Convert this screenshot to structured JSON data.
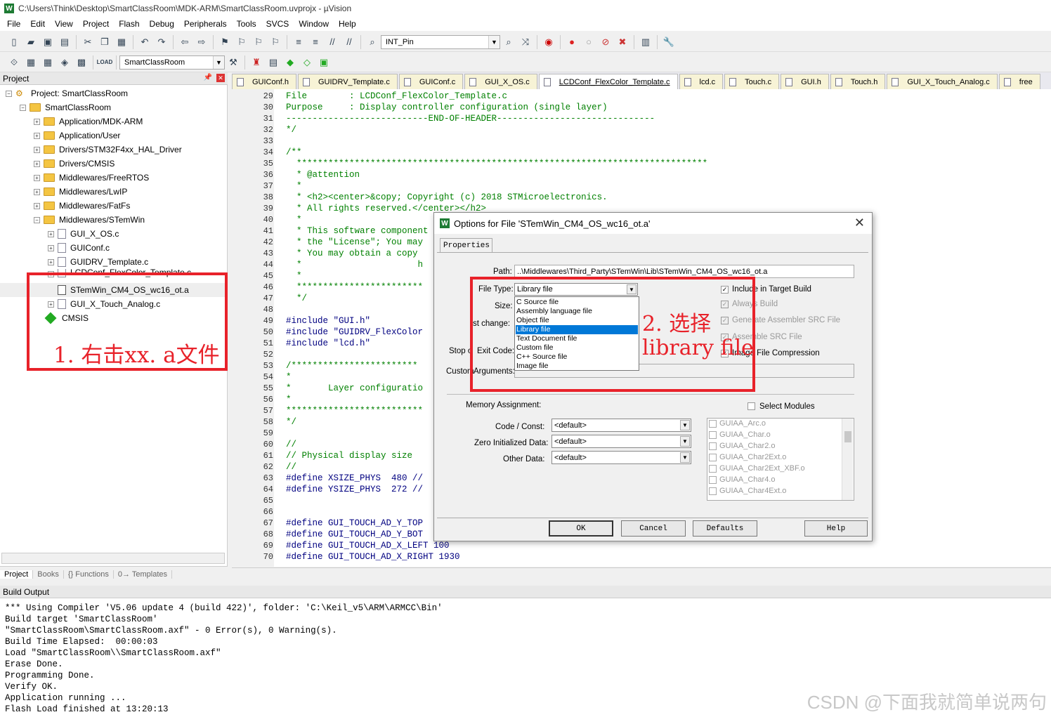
{
  "window": {
    "title": "C:\\Users\\Think\\Desktop\\SmartClassRoom\\MDK-ARM\\SmartClassRoom.uvprojx - µVision",
    "app_icon": "W"
  },
  "menu": [
    "File",
    "Edit",
    "View",
    "Project",
    "Flash",
    "Debug",
    "Peripherals",
    "Tools",
    "SVCS",
    "Window",
    "Help"
  ],
  "toolbar": {
    "find_combo": "INT_Pin",
    "target_combo": "SmartClassRoom",
    "load_label": "LOAD"
  },
  "project_panel": {
    "title": "Project",
    "tree": [
      {
        "label": "Project: SmartClassRoom"
      },
      {
        "label": "SmartClassRoom"
      },
      {
        "label": "Application/MDK-ARM"
      },
      {
        "label": "Application/User"
      },
      {
        "label": "Drivers/STM32F4xx_HAL_Driver"
      },
      {
        "label": "Drivers/CMSIS"
      },
      {
        "label": "Middlewares/FreeRTOS"
      },
      {
        "label": "Middlewares/LwIP"
      },
      {
        "label": "Middlewares/FatFs"
      },
      {
        "label": "Middlewares/STemWin"
      },
      {
        "label": "GUI_X_OS.c"
      },
      {
        "label": "GUIConf.c"
      },
      {
        "label": "GUIDRV_Template.c"
      },
      {
        "label": "LCDConf_FlexColor_Template.c"
      },
      {
        "label": "STemWin_CM4_OS_wc16_ot.a"
      },
      {
        "label": "GUI_X_Touch_Analog.c"
      },
      {
        "label": "CMSIS"
      }
    ],
    "tabs": [
      "Project",
      "Books",
      "{} Functions",
      "0→ Templates"
    ]
  },
  "file_tabs": [
    "GUIConf.h",
    "GUIDRV_Template.c",
    "GUIConf.c",
    "GUI_X_OS.c",
    "LCDConf_FlexColor_Template.c",
    "lcd.c",
    "Touch.c",
    "GUI.h",
    "Touch.h",
    "GUI_X_Touch_Analog.c",
    "free"
  ],
  "editor": {
    "lines": [
      {
        "n": "29",
        "t": "File        : LCDConf_FlexColor_Template.c",
        "c": "cm"
      },
      {
        "n": "30",
        "t": "Purpose     : Display controller configuration (single layer)",
        "c": "cm"
      },
      {
        "n": "31",
        "t": "---------------------------END-OF-HEADER------------------------------",
        "c": "cm"
      },
      {
        "n": "32",
        "t": "*/",
        "c": "cm"
      },
      {
        "n": "33",
        "t": "",
        "c": "cm"
      },
      {
        "n": "34",
        "t": "/**",
        "c": "cm"
      },
      {
        "n": "35",
        "t": "  ******************************************************************************",
        "c": "cm"
      },
      {
        "n": "36",
        "t": "  * @attention",
        "c": "cm"
      },
      {
        "n": "37",
        "t": "  *",
        "c": "cm"
      },
      {
        "n": "38",
        "t": "  * <h2><center>&copy; Copyright (c) 2018 STMicroelectronics.",
        "c": "cm"
      },
      {
        "n": "39",
        "t": "  * All rights reserved.</center></h2>",
        "c": "cm"
      },
      {
        "n": "40",
        "t": "  *",
        "c": "cm"
      },
      {
        "n": "41",
        "t": "  * This software component",
        "c": "cm"
      },
      {
        "n": "42",
        "t": "  * the \"License\"; You may",
        "c": "cm"
      },
      {
        "n": "43",
        "t": "  * You may obtain a copy",
        "c": "cm"
      },
      {
        "n": "44",
        "t": "  *                      h",
        "c": "cm"
      },
      {
        "n": "45",
        "t": "  *",
        "c": "cm"
      },
      {
        "n": "46",
        "t": "  ************************",
        "c": "cm"
      },
      {
        "n": "47",
        "t": "  */",
        "c": "cm"
      },
      {
        "n": "48",
        "t": "",
        "c": "cm"
      },
      {
        "n": "49",
        "t": "#include \"GUI.h\"",
        "c": "pp"
      },
      {
        "n": "50",
        "t": "#include \"GUIDRV_FlexColor",
        "c": "pp"
      },
      {
        "n": "51",
        "t": "#include \"lcd.h\"",
        "c": "pp"
      },
      {
        "n": "52",
        "t": "",
        "c": "cm"
      },
      {
        "n": "53",
        "t": "/************************",
        "c": "cm"
      },
      {
        "n": "54",
        "t": "*",
        "c": "cm"
      },
      {
        "n": "55",
        "t": "*       Layer configuratio",
        "c": "cm"
      },
      {
        "n": "56",
        "t": "*",
        "c": "cm"
      },
      {
        "n": "57",
        "t": "**************************",
        "c": "cm"
      },
      {
        "n": "58",
        "t": "*/",
        "c": "cm"
      },
      {
        "n": "59",
        "t": "",
        "c": "cm"
      },
      {
        "n": "60",
        "t": "//",
        "c": "cm"
      },
      {
        "n": "61",
        "t": "// Physical display size",
        "c": "cm"
      },
      {
        "n": "62",
        "t": "//",
        "c": "cm"
      },
      {
        "n": "63",
        "t": "#define XSIZE_PHYS  480 //",
        "c": "pp"
      },
      {
        "n": "64",
        "t": "#define YSIZE_PHYS  272 //",
        "c": "pp"
      },
      {
        "n": "65",
        "t": "",
        "c": "cm"
      },
      {
        "n": "66",
        "t": "",
        "c": "cm"
      },
      {
        "n": "67",
        "t": "#define GUI_TOUCH_AD_Y_TOP",
        "c": "pp"
      },
      {
        "n": "68",
        "t": "#define GUI_TOUCH_AD_Y_BOT",
        "c": "pp"
      },
      {
        "n": "69",
        "t": "#define GUI_TOUCH_AD_X_LEFT 100",
        "c": "pp"
      },
      {
        "n": "70",
        "t": "#define GUI_TOUCH_AD_X_RIGHT 1930",
        "c": "pp"
      }
    ]
  },
  "build_output": {
    "title": "Build Output",
    "lines": [
      "*** Using Compiler 'V5.06 update 4 (build 422)', folder: 'C:\\Keil_v5\\ARM\\ARMCC\\Bin'",
      "Build target 'SmartClassRoom'",
      "\"SmartClassRoom\\SmartClassRoom.axf\" - 0 Error(s), 0 Warning(s).",
      "Build Time Elapsed:  00:00:03",
      "Load \"SmartClassRoom\\\\SmartClassRoom.axf\"",
      "Erase Done.",
      "Programming Done.",
      "Verify OK.",
      "Application running ...",
      "Flash Load finished at 13:20:13"
    ]
  },
  "dialog": {
    "title": "Options for File 'STemWin_CM4_OS_wc16_ot.a'",
    "tab": "Properties",
    "path_label": "Path:",
    "path_value": "..\\Middlewares\\Third_Party\\STemWin\\Lib\\STemWin_CM4_OS_wc16_ot.a",
    "file_type_label": "File Type:",
    "file_type_value": "Library file",
    "size_label": "Size:",
    "last_change_label": "st change:",
    "stop_label": "Stop o",
    "exit_code_label": "Exit Code:",
    "custom_label": "Custom",
    "arguments_label": "Arguments:",
    "file_type_options": [
      "C Source file",
      "Assembly language file",
      "Object file",
      "Library file",
      "Text Document file",
      "Custom file",
      "C++ Source file",
      "Image file"
    ],
    "selected_option": "Library file",
    "checks": [
      {
        "label": "Include in Target Build",
        "checked": true
      },
      {
        "label": "Always Build",
        "checked": true
      },
      {
        "label": "Generate Assembler SRC File",
        "checked": true
      },
      {
        "label": "Assemble SRC File",
        "checked": true
      },
      {
        "label": "Image File Compression",
        "checked": true
      }
    ],
    "memory_label": "Memory Assignment:",
    "select_modules_label": "Select Modules",
    "code_const_label": "Code / Const:",
    "zero_init_label": "Zero Initialized Data:",
    "other_data_label": "Other Data:",
    "default_value": "<default>",
    "modules": [
      "GUIAA_Arc.o",
      "GUIAA_Char.o",
      "GUIAA_Char2.o",
      "GUIAA_Char2Ext.o",
      "GUIAA_Char2Ext_XBF.o",
      "GUIAA_Char4.o",
      "GUIAA_Char4Ext.o"
    ],
    "buttons": {
      "ok": "OK",
      "cancel": "Cancel",
      "defaults": "Defaults",
      "help": "Help"
    }
  },
  "annotations": {
    "step1": "1. 右击xx. a文件",
    "step2_line1": "2. 选择",
    "step2_line2": "library file",
    "color": "#e8222a"
  },
  "watermark": "CSDN @下面我就简单说两句"
}
